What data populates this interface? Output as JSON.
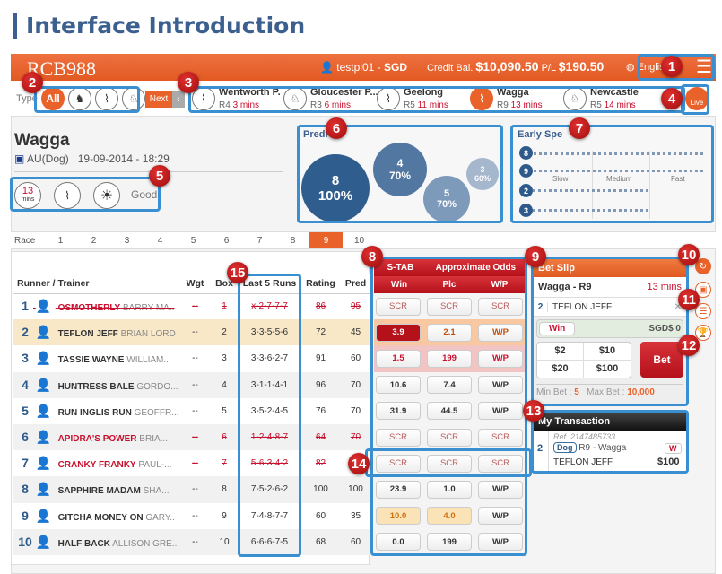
{
  "page_title": "Interface Introduction",
  "header": {
    "logo": "RCB988",
    "user": "testpl01",
    "currency": "SGD",
    "credit_label": "Credit Bal.",
    "credit": "$10,090.50",
    "pl_label": "P/L",
    "pl": "$190.50",
    "language": "English",
    "accent": "#e8622a"
  },
  "type_filter": {
    "label": "Type",
    "all": "All",
    "icons": [
      "horse-racing-icon",
      "greyhound-icon",
      "harness-icon"
    ]
  },
  "next_label": "Next",
  "live_label": "Live",
  "venues": [
    {
      "name": "Wentworth P.",
      "race": "R4",
      "time": "3 mins",
      "icon": "greyhound-icon"
    },
    {
      "name": "Gloucester P...",
      "race": "R3",
      "time": "6 mins",
      "icon": "harness-icon"
    },
    {
      "name": "Geelong",
      "race": "R5",
      "time": "11 mins",
      "icon": "greyhound-icon"
    },
    {
      "name": "Wagga",
      "race": "R9",
      "time": "13 mins",
      "icon": "greyhound-icon"
    },
    {
      "name": "Newcastle",
      "race": "R5",
      "time": "14 mins",
      "icon": "harness-icon"
    }
  ],
  "race": {
    "venue": "Wagga",
    "country": "AU(Dog)",
    "datetime": "19-09-2014 - 18:29",
    "countdown": "13",
    "countdown_unit": "mins",
    "condition": "Good"
  },
  "prediction": {
    "title": "Predi",
    "bubbles": [
      {
        "runner": "8",
        "pct": "100%"
      },
      {
        "runner": "4",
        "pct": "70%"
      },
      {
        "runner": "5",
        "pct": "70%"
      },
      {
        "runner": "3",
        "pct": "60%"
      }
    ]
  },
  "early_speed": {
    "title": "Early Spe",
    "scale": [
      "Slow",
      "Medium",
      "Fast"
    ],
    "runners": [
      "8",
      "9",
      "2",
      "3"
    ]
  },
  "race_tabs": {
    "label": "Race",
    "items": [
      "1",
      "2",
      "3",
      "4",
      "5",
      "6",
      "7",
      "8",
      "9",
      "10"
    ],
    "active": "9"
  },
  "table": {
    "headers": [
      "Runner / Trainer",
      "Wgt",
      "Box",
      "Last 5 Runs",
      "Rating",
      "Pred"
    ],
    "rows": [
      {
        "no": "1",
        "runner": "OSMOTHERLY",
        "trainer": "BARRY MA..",
        "wgt": "--",
        "box": "1",
        "last5": "x-2-7-7-7",
        "rating": "86",
        "pred": "95",
        "scratched": true,
        "odds": [
          "SCR",
          "SCR",
          "SCR"
        ]
      },
      {
        "no": "2",
        "runner": "TEFLON JEFF",
        "trainer": "BRIAN LORD",
        "wgt": "--",
        "box": "2",
        "last5": "3-3-5-5-6",
        "rating": "72",
        "pred": "45",
        "selected": true,
        "odds": [
          "3.9",
          "2.1",
          "W/P"
        ]
      },
      {
        "no": "3",
        "runner": "TASSIE WAYNE",
        "trainer": "WILLIAM..",
        "wgt": "--",
        "box": "3",
        "last5": "3-3-6-2-7",
        "rating": "91",
        "pred": "60",
        "odds": [
          "1.5",
          "199",
          "W/P"
        ]
      },
      {
        "no": "4",
        "runner": "HUNTRESS BALE",
        "trainer": "GORDO...",
        "wgt": "--",
        "box": "4",
        "last5": "3-1-1-4-1",
        "rating": "96",
        "pred": "70",
        "odds": [
          "10.6",
          "7.4",
          "W/P"
        ]
      },
      {
        "no": "5",
        "runner": "RUN INGLIS RUN",
        "trainer": "GEOFFR...",
        "wgt": "--",
        "box": "5",
        "last5": "3-5-2-4-5",
        "rating": "76",
        "pred": "70",
        "odds": [
          "31.9",
          "44.5",
          "W/P"
        ]
      },
      {
        "no": "6",
        "runner": "APIDRA'S POWER",
        "trainer": "BRIA...",
        "wgt": "--",
        "box": "6",
        "last5": "1-2-4-8-7",
        "rating": "64",
        "pred": "70",
        "scratched": true,
        "odds": [
          "SCR",
          "SCR",
          "SCR"
        ]
      },
      {
        "no": "7",
        "runner": "CRANKY FRANKY",
        "trainer": "PAUL-...",
        "wgt": "--",
        "box": "7",
        "last5": "5-6-3-4-2",
        "rating": "82",
        "pred": "",
        "scratched": true,
        "odds": [
          "SCR",
          "SCR",
          "SCR"
        ]
      },
      {
        "no": "8",
        "runner": "SAPPHIRE MADAM",
        "trainer": "SHA...",
        "wgt": "--",
        "box": "8",
        "last5": "7-5-2-6-2",
        "rating": "100",
        "pred": "100",
        "odds": [
          "23.9",
          "1.0",
          "W/P"
        ]
      },
      {
        "no": "9",
        "runner": "GITCHA MONEY ON",
        "trainer": "GARY..",
        "wgt": "--",
        "box": "9",
        "last5": "7-4-8-7-7",
        "rating": "60",
        "pred": "35",
        "odds": [
          "10.0",
          "4.0",
          "W/P"
        ]
      },
      {
        "no": "10",
        "runner": "HALF BACK",
        "trainer": "ALLISON GRE..",
        "wgt": "--",
        "box": "10",
        "last5": "6-6-6-7-5",
        "rating": "68",
        "pred": "60",
        "odds": [
          "0.0",
          "199",
          "W/P"
        ]
      }
    ]
  },
  "odds": {
    "title_left": "S-TAB",
    "title_right": "Approximate Odds",
    "cols": [
      "Win",
      "Plc",
      "W/P"
    ]
  },
  "bet_slip": {
    "title": "Bet Slip",
    "race": "Wagga - R9",
    "time": "13 mins",
    "runner_no": "2",
    "runner": "TEFLON JEFF",
    "bet_type": "Win",
    "amount": "SGD$ 0",
    "chips": [
      "$2",
      "$10",
      "$20",
      "$100"
    ],
    "bet_label": "Bet",
    "min_label": "Min Bet :",
    "min": "5",
    "max_label": "Max Bet :",
    "max": "10,000"
  },
  "transaction": {
    "title": "My Transaction",
    "ref": "Ref. 2147485733",
    "no": "2",
    "tag": "Dog",
    "race": "R9 - Wagga",
    "type": "W",
    "runner": "TEFLON JEFF",
    "amount": "$100"
  },
  "callouts": [
    "1",
    "2",
    "3",
    "4",
    "5",
    "6",
    "7",
    "8",
    "9",
    "10",
    "11",
    "12",
    "13",
    "14",
    "15"
  ]
}
